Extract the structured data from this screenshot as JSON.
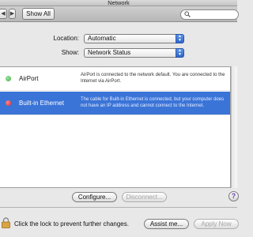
{
  "window": {
    "title": "Network"
  },
  "toolbar": {
    "back_glyph": "◀",
    "forward_glyph": "▶",
    "show_all_label": "Show All",
    "search_icon": "search-icon",
    "search_value": "",
    "search_placeholder": ""
  },
  "location": {
    "label": "Location:",
    "value": "Automatic"
  },
  "show": {
    "label": "Show:",
    "value": "Network Status"
  },
  "services": [
    {
      "name": "AirPort",
      "status_color": "#3fb34a",
      "description": "AirPort is connected to the network default. You are connected to the Internet via AirPort."
    },
    {
      "name": "Built-in Ethernet",
      "status_color": "#d8262b",
      "description": "The cable for Built-in Ethernet is connected, but your computer does not have an IP address and cannot connect to the Internet."
    }
  ],
  "actions": {
    "configure_label": "Configure...",
    "disconnect_label": "Disconnect...",
    "help_glyph": "?"
  },
  "footer": {
    "lock_text": "Click the lock to prevent further changes.",
    "assist_label": "Assist me...",
    "apply_label": "Apply Now"
  },
  "colors": {
    "selection": "#3b74d7",
    "popup_stepper": "#2f66c9"
  }
}
